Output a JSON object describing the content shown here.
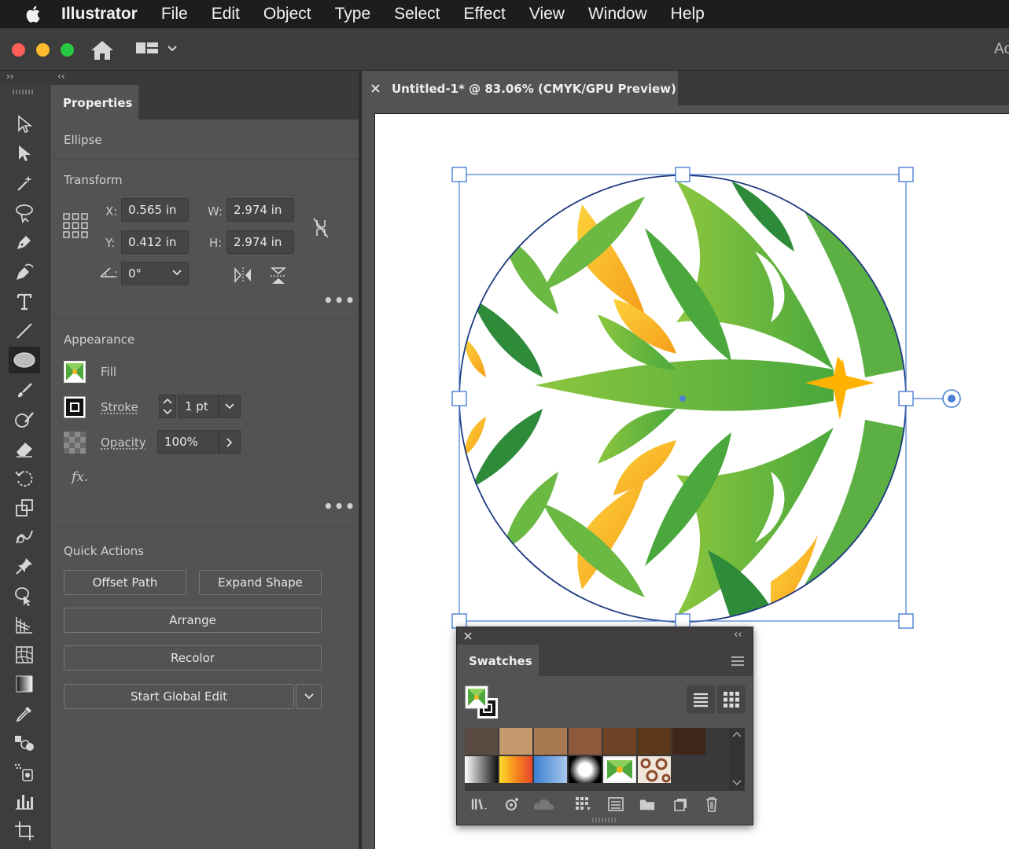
{
  "menubar": {
    "app_name": "Illustrator",
    "items": [
      "File",
      "Edit",
      "Object",
      "Type",
      "Select",
      "Effect",
      "View",
      "Window",
      "Help"
    ]
  },
  "appbar": {
    "right_text": "Ac"
  },
  "strip": {
    "left_arrows": "››",
    "right_arrows": "‹‹"
  },
  "properties": {
    "tab_label": "Properties",
    "object_type": "Ellipse",
    "transform": {
      "title": "Transform",
      "x_label": "X:",
      "x_value": "0.565 in",
      "y_label": "Y:",
      "y_value": "0.412 in",
      "w_label": "W:",
      "w_value": "2.974 in",
      "h_label": "H:",
      "h_value": "2.974 in",
      "angle_value": "0°"
    },
    "appearance": {
      "title": "Appearance",
      "fill_label": "Fill",
      "stroke_label": "Stroke",
      "stroke_value": "1 pt",
      "opacity_label": "Opacity",
      "opacity_value": "100%",
      "fx_label": "fx."
    },
    "quick_actions": {
      "title": "Quick Actions",
      "offset_path": "Offset Path",
      "expand_shape": "Expand Shape",
      "arrange": "Arrange",
      "recolor": "Recolor",
      "start_global_edit": "Start Global Edit"
    },
    "more_dots": "•••"
  },
  "document": {
    "tab_title": "Untitled-1* @ 83.06% (CMYK/GPU Preview)"
  },
  "swatches": {
    "tab_label": "Swatches",
    "row1_colors": [
      "#5a4a42",
      "#c49a6c",
      "#a87a52",
      "#8c5a3a",
      "#6e4325",
      "#5a3818",
      "#3e2618"
    ]
  },
  "colors": {
    "accent_selection": "#4a7fd4",
    "leaf_green_dark": "#2e8b3a",
    "leaf_green": "#6bb843",
    "leaf_yellow": "#f7b21c"
  }
}
